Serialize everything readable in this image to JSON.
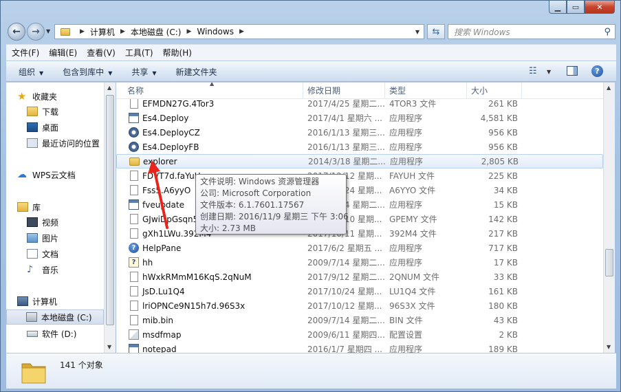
{
  "address": {
    "crumbs": [
      "计算机",
      "本地磁盘 (C:)",
      "Windows"
    ]
  },
  "search": {
    "placeholder": "搜索 Windows"
  },
  "menu": [
    "文件(F)",
    "编辑(E)",
    "查看(V)",
    "工具(T)",
    "帮助(H)"
  ],
  "commands": {
    "organize": "组织",
    "include_library": "包含到库中",
    "share": "共享",
    "new_folder": "新建文件夹"
  },
  "nav": {
    "favorites": "收藏夹",
    "downloads": "下载",
    "desktop": "桌面",
    "recent": "最近访问的位置",
    "wps": "WPS云文档",
    "libraries": "库",
    "videos": "视频",
    "pictures": "图片",
    "documents": "文档",
    "music": "音乐",
    "computer": "计算机",
    "disk_c": "本地磁盘 (C:)",
    "disk_d": "软件 (D:)"
  },
  "columns": {
    "name": "名称",
    "date": "修改日期",
    "type": "类型",
    "size": "大小"
  },
  "files": [
    {
      "name": "EFMDN27G.4Tor3",
      "date": "2017/4/25 星期二...",
      "type": "4TOR3 文件",
      "size": "261 KB",
      "icon": "doc"
    },
    {
      "name": "Es4.Deploy",
      "date": "2017/4/1 星期六 ...",
      "type": "应用程序",
      "size": "4,581 KB",
      "icon": "exe"
    },
    {
      "name": "Es4.DeployCZ",
      "date": "2016/1/13 星期三...",
      "type": "应用程序",
      "size": "956 KB",
      "icon": "gear"
    },
    {
      "name": "Es4.DeployFB",
      "date": "2016/1/13 星期三...",
      "type": "应用程序",
      "size": "956 KB",
      "icon": "gear"
    },
    {
      "name": "explorer",
      "date": "2014/3/18 星期二...",
      "type": "应用程序",
      "size": "2,805 KB",
      "icon": "folder"
    },
    {
      "name": "FDVT7d.faYuH",
      "date": "2017/12/12 星期...",
      "type": "FAYUH 文件",
      "size": "225 KB",
      "icon": "doc"
    },
    {
      "name": "Fss5.A6yyO",
      "date": "2017/10/24 星期...",
      "type": "A6YYO 文件",
      "size": "34 KB",
      "icon": "doc"
    },
    {
      "name": "fveupdate",
      "date": "2009/7/14 星期二...",
      "type": "应用程序",
      "size": "15 KB",
      "icon": "exe"
    },
    {
      "name": "GJwiDpGsqn5.GPemy",
      "date": "2017/10/10 星期...",
      "type": "GPEMY 文件",
      "size": "142 KB",
      "icon": "doc"
    },
    {
      "name": "gXh1LWu.392M4",
      "date": "2017/10/11 星期...",
      "type": "392M4 文件",
      "size": "217 KB",
      "icon": "doc"
    },
    {
      "name": "HelpPane",
      "date": "2017/6/2 星期五 ...",
      "type": "应用程序",
      "size": "717 KB",
      "icon": "help"
    },
    {
      "name": "hh",
      "date": "2009/7/14 星期二...",
      "type": "应用程序",
      "size": "17 KB",
      "icon": "hh"
    },
    {
      "name": "hWxkRMmM16KqS.2qNuM",
      "date": "2017/9/12 星期二...",
      "type": "2QNUM 文件",
      "size": "33 KB",
      "icon": "doc"
    },
    {
      "name": "JsD.Lu1Q4",
      "date": "2017/10/24 星期...",
      "type": "LU1Q4 文件",
      "size": "161 KB",
      "icon": "doc"
    },
    {
      "name": "lriOPNCe9N15h7d.96S3x",
      "date": "2017/10/12 星期...",
      "type": "96S3X 文件",
      "size": "180 KB",
      "icon": "doc"
    },
    {
      "name": "mib.bin",
      "date": "2009/7/14 星期二...",
      "type": "BIN 文件",
      "size": "43 KB",
      "icon": "doc"
    },
    {
      "name": "msdfmap",
      "date": "2009/6/11 星期四...",
      "type": "配置设置",
      "size": "2 KB",
      "icon": "cfg"
    },
    {
      "name": "notepad",
      "date": "2016/1/7 星期四 ...",
      "type": "应用程序",
      "size": "189 KB",
      "icon": "exe"
    }
  ],
  "tooltip": {
    "line1": "文件说明: Windows 资源管理器",
    "line2": "公司: Microsoft Corporation",
    "line3": "文件版本: 6.1.7601.17567",
    "line4": "创建日期: 2016/11/9 星期三 下午 3:06",
    "line5": "大小: 2.73 MB"
  },
  "status": {
    "count": "141 个对象"
  }
}
